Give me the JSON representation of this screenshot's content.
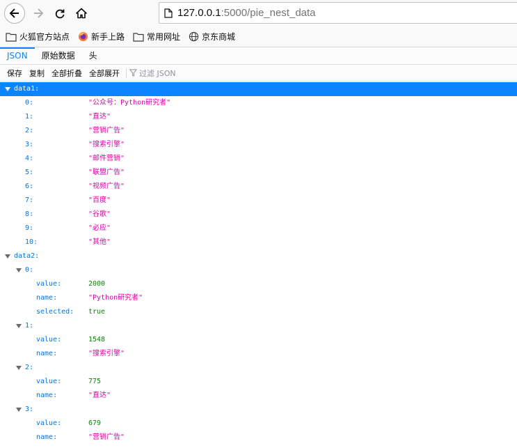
{
  "browser": {
    "url_host": "127.0.0.1",
    "url_path": ":5000/pie_nest_data"
  },
  "bookmarks": [
    {
      "label": "火狐官方站点",
      "icon": "folder-icon"
    },
    {
      "label": "新手上路",
      "icon": "firefox-icon"
    },
    {
      "label": "常用网址",
      "icon": "folder-icon"
    },
    {
      "label": "京东商城",
      "icon": "globe-icon"
    }
  ],
  "tabs": {
    "json": "JSON",
    "raw": "原始数据",
    "headers": "头"
  },
  "toolbar": {
    "save": "保存",
    "copy": "复制",
    "collapse_all": "全部折叠",
    "expand_all": "全部展开",
    "filter_placeholder": "过滤 JSON"
  },
  "tree": {
    "data1_key": "data1:",
    "data1_items": [
      {
        "key": "0:",
        "value": "\"公众号：Python研究者\""
      },
      {
        "key": "1:",
        "value": "\"直达\""
      },
      {
        "key": "2:",
        "value": "\"营销广告\""
      },
      {
        "key": "3:",
        "value": "\"搜索引擎\""
      },
      {
        "key": "4:",
        "value": "\"邮件营销\""
      },
      {
        "key": "5:",
        "value": "\"联盟广告\""
      },
      {
        "key": "6:",
        "value": "\"视频广告\""
      },
      {
        "key": "7:",
        "value": "\"百度\""
      },
      {
        "key": "8:",
        "value": "\"谷歌\""
      },
      {
        "key": "9:",
        "value": "\"必应\""
      },
      {
        "key": "10:",
        "value": "\"其他\""
      }
    ],
    "data2_key": "data2:",
    "data2_items": [
      {
        "key": "0:",
        "value": "2000",
        "name": "\"Python研究者\"",
        "selected": "true"
      },
      {
        "key": "1:",
        "value": "1548",
        "name": "\"搜索引擎\""
      },
      {
        "key": "2:",
        "value": "775",
        "name": "\"直达\""
      },
      {
        "key": "3:",
        "value": "679",
        "name": "\"营销广告\""
      }
    ],
    "value_label": "value:",
    "name_label": "name:",
    "selected_label": "selected:"
  }
}
